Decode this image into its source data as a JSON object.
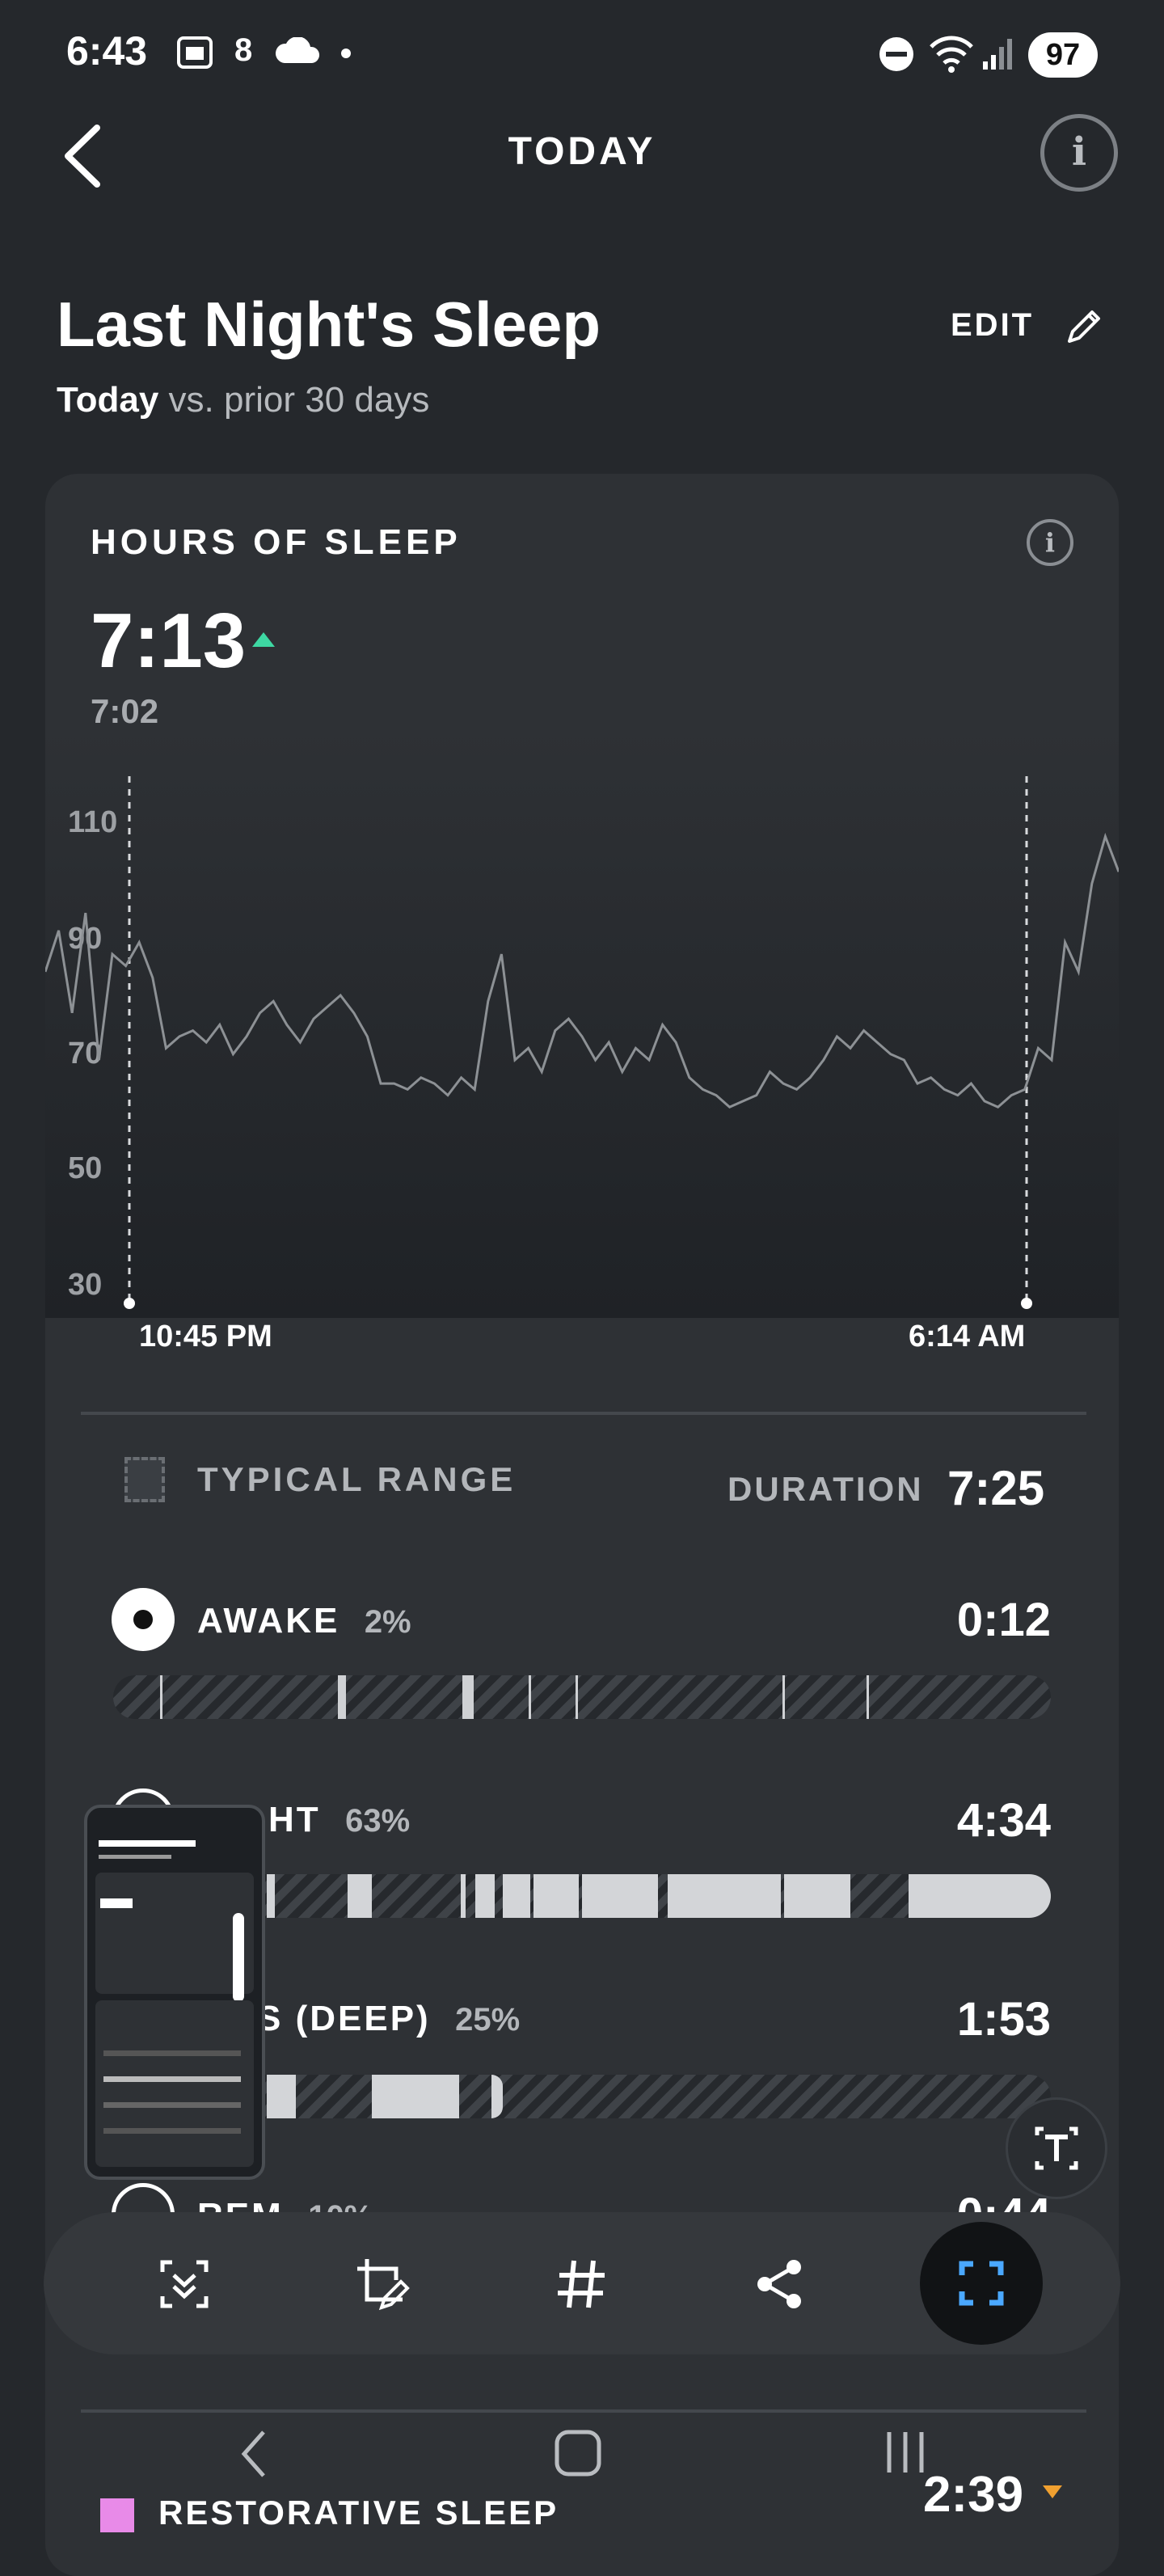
{
  "status_bar": {
    "time": "6:43",
    "icons": [
      "screenshot-icon",
      "notification-icon",
      "cloud-icon",
      "dot-icon",
      "dnd-icon",
      "wifi-icon",
      "signal-icon"
    ],
    "small_digit": "8",
    "battery": "97"
  },
  "header": {
    "title": "TODAY",
    "info": "i"
  },
  "page": {
    "heading": "Last Night's Sleep",
    "subtitle_bold": "Today",
    "subtitle_rest": " vs. prior 30 days",
    "edit_label": "EDIT"
  },
  "card": {
    "title": "HOURS OF SLEEP",
    "value": "7:13",
    "trend": "up",
    "trend_color": "#3ed8a3",
    "average": "7:02"
  },
  "chart_data": {
    "type": "line",
    "ylabels": [
      "110",
      "90",
      "70",
      "50",
      "30"
    ],
    "ylim": [
      30,
      110
    ],
    "x_start_label": "10:45 PM",
    "x_end_label": "6:14 AM",
    "series": [
      {
        "values": [
          85,
          92,
          78,
          95,
          70,
          88,
          86,
          90,
          84,
          72,
          74,
          75,
          73,
          76,
          71,
          74,
          78,
          80,
          76,
          73,
          77,
          79,
          81,
          78,
          74,
          66,
          66,
          65,
          67,
          66,
          64,
          67,
          65,
          80,
          88,
          70,
          72,
          68,
          75,
          77,
          74,
          70,
          73,
          68,
          72,
          70,
          76,
          73,
          67,
          65,
          64,
          62,
          63,
          64,
          68,
          66,
          65,
          67,
          70,
          74,
          72,
          75,
          73,
          71,
          70,
          66,
          67,
          65,
          64,
          66,
          63,
          62,
          64,
          65,
          72,
          70,
          90,
          85,
          100,
          108,
          102
        ]
      }
    ]
  },
  "summary": {
    "typical_range": "TYPICAL RANGE",
    "duration_label": "DURATION",
    "duration_value": "7:25"
  },
  "stages": [
    {
      "name": "AWAKE",
      "pct": "2%",
      "value": "0:12"
    },
    {
      "name": "HT",
      "pct": "63%",
      "value": "4:34"
    },
    {
      "name": "S (DEEP)",
      "pct": "25%",
      "value": "1:53"
    },
    {
      "name": "REM",
      "pct": "10%",
      "value": "0:44"
    }
  ],
  "bottom": {
    "restorative_label": "RESTORATIVE SLEEP",
    "restorative_value": "2:39"
  },
  "colors": {
    "background": "#25282c",
    "card": "#2e3135",
    "accent_up": "#3ed8a3",
    "restorative": "#e88ae8",
    "down": "#f0a030"
  }
}
